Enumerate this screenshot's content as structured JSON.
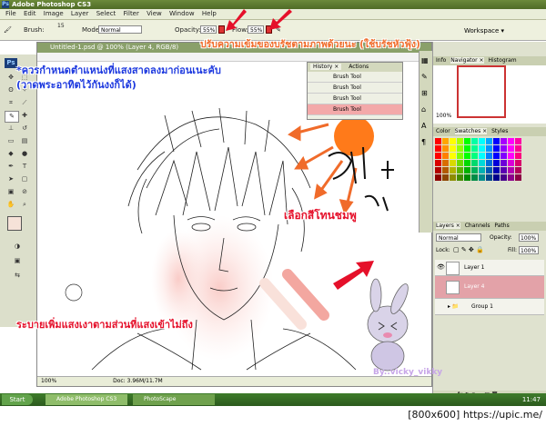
{
  "titlebar": {
    "title": "Adobe Photoshop CS3"
  },
  "menu": [
    "File",
    "Edit",
    "Image",
    "Layer",
    "Select",
    "Filter",
    "View",
    "Window",
    "Help"
  ],
  "options": {
    "brush_label": "Brush:",
    "brush_size": "15",
    "mode_label": "Mode:",
    "mode_value": "Normal",
    "opacity_label": "Opacity:",
    "opacity_value": "55%",
    "flow_label": "Flow:",
    "flow_value": "55%",
    "workspace": "Workspace ▾"
  },
  "document": {
    "tab": "Untitled-1.psd @ 100% (Layer 4, RGB/8)",
    "status_zoom": "100%",
    "status_doc": "Doc: 3.96M/11.7M"
  },
  "history": {
    "tabs": [
      "History ×",
      "Actions"
    ],
    "rows": [
      "Brush Tool",
      "Brush Tool",
      "Brush Tool",
      "Brush Tool"
    ]
  },
  "navigator": {
    "tabs": [
      "Info",
      "Navigator ×",
      "Histogram"
    ],
    "zoom": "100%"
  },
  "swatches": {
    "tabs": [
      "Color",
      "Swatches ×",
      "Styles"
    ]
  },
  "layers": {
    "tabs": [
      "Layers ×",
      "Channels",
      "Paths"
    ],
    "mode": "Normal",
    "opacity_label": "Opacity:",
    "opacity": "100%",
    "lock_label": "Lock:",
    "fill_label": "Fill:",
    "fill": "100%",
    "rows": [
      "Layer 1",
      "Layer 4",
      "Group 1"
    ]
  },
  "taskbar": {
    "start": "Start",
    "tasks": [
      "Adobe Photoshop CS3",
      "PhotoScape"
    ],
    "clock": "11:47"
  },
  "annotations": {
    "top": "ปรับความเข้มของบรัชตามภาพด้วยนะ (ใช้บรัชหัวฟุ้ง)",
    "left_line1": "*ควรกำหนดตำแหน่งที่แสงสาดลงมาก่อนเนะคับ",
    "left_line2": "(วาดพระอาทิตไว้กันงงก็ได้)",
    "pink": "เลือกสีโทนชมพู",
    "bottom": "ระบายเพิ่มแสงเงาตามส่วนที่แสงเข้าไม่ถึง",
    "signature": "By..vicky_vikky"
  },
  "footer": "[800x600] https://upic.me/",
  "colors": {
    "sun": "#ff7a1a",
    "pink_stroke": "#f3a7a0",
    "accent_red": "#e5102a",
    "accent_blue": "#1e3adf"
  }
}
